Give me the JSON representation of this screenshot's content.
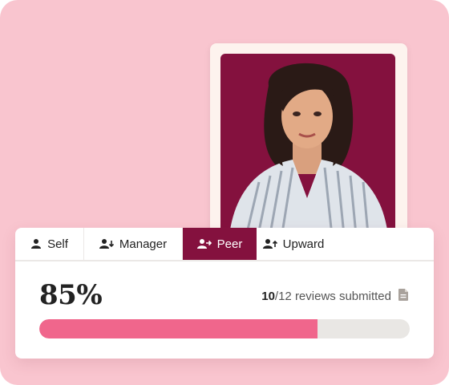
{
  "tabs": [
    {
      "label": "Self",
      "icon": "person-icon",
      "active": false
    },
    {
      "label": "Manager",
      "icon": "person-arrow-down-icon",
      "active": false
    },
    {
      "label": "Peer",
      "icon": "person-arrow-right-icon",
      "active": true
    },
    {
      "label": "Upward",
      "icon": "person-arrow-up-icon",
      "active": false
    }
  ],
  "stats": {
    "percent_label": "85%",
    "submitted_count": "10",
    "submitted_rest": "/12 reviews submitted",
    "doc_icon": "document-icon",
    "progress_fraction": 0.75
  },
  "colors": {
    "background": "#f9c5cf",
    "accent": "#84113e",
    "progress": "#f0668c",
    "track": "#e9e7e4"
  }
}
